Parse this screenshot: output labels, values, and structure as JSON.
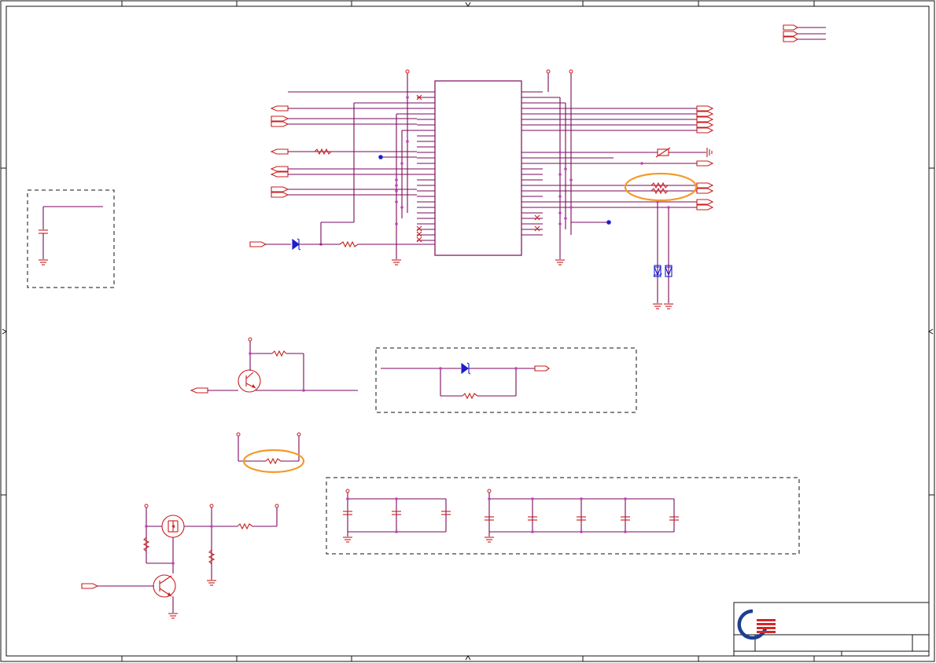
{
  "schematic": {
    "wire_color": "#7a0a5c",
    "component_color": "#c81d1d",
    "diode_color": "#1d1dcc",
    "highlight_color": "#f39a2b",
    "frame_color": "#111111"
  },
  "title_block": {
    "logo_colors": {
      "ring": "#1d3f8f",
      "stripes": "#d62828"
    },
    "logo_icon": "company-logo-icon"
  }
}
